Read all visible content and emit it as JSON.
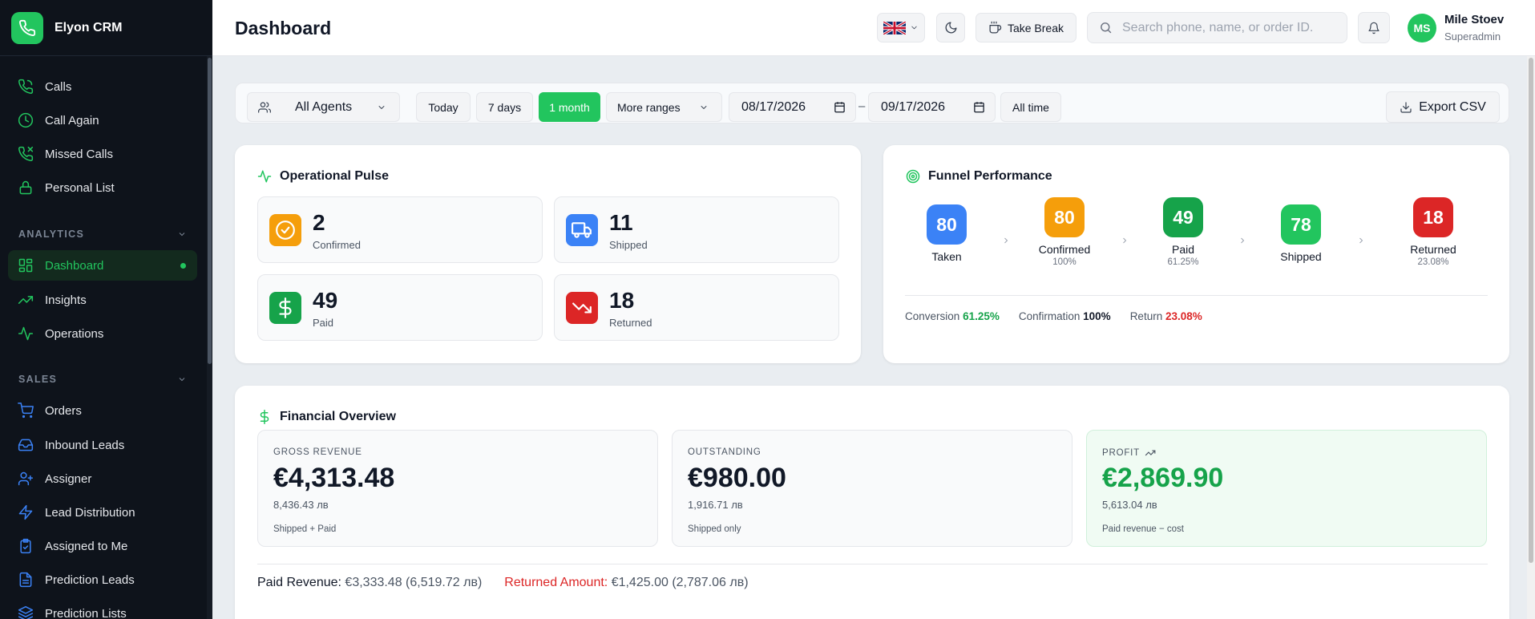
{
  "app": {
    "name": "Elyon CRM"
  },
  "sidebar": {
    "top_items": [
      {
        "label": "Calls",
        "icon": "phone-icon"
      },
      {
        "label": "Call Again",
        "icon": "clock-icon"
      },
      {
        "label": "Missed Calls",
        "icon": "phone-missed-icon"
      },
      {
        "label": "Personal List",
        "icon": "lock-icon"
      }
    ],
    "analytics": {
      "title": "ANALYTICS",
      "items": [
        {
          "label": "Dashboard",
          "icon": "grid-icon",
          "active": true
        },
        {
          "label": "Insights",
          "icon": "trending-up-icon"
        },
        {
          "label": "Operations",
          "icon": "activity-icon"
        }
      ]
    },
    "sales": {
      "title": "SALES",
      "items": [
        {
          "label": "Orders",
          "icon": "cart-icon"
        },
        {
          "label": "Inbound Leads",
          "icon": "inbox-icon"
        },
        {
          "label": "Assigner",
          "icon": "user-plus-icon"
        },
        {
          "label": "Lead Distribution",
          "icon": "zap-icon"
        },
        {
          "label": "Assigned to Me",
          "icon": "clipboard-icon"
        },
        {
          "label": "Prediction Leads",
          "icon": "file-icon"
        },
        {
          "label": "Prediction Lists",
          "icon": "layers-icon"
        }
      ]
    }
  },
  "header": {
    "title": "Dashboard",
    "take_break": "Take Break",
    "search_placeholder": "Search phone, name, or order ID.",
    "user": {
      "initials": "MS",
      "name": "Mile Stoev",
      "role": "Superadmin"
    }
  },
  "filters": {
    "agents": "All Agents",
    "today": "Today",
    "seven_days": "7 days",
    "one_month": "1 month",
    "more_ranges": "More ranges",
    "date_from": "08/17/2026",
    "date_sep": "–",
    "date_to": "09/17/2026",
    "all_time": "All time",
    "export": "Export CSV"
  },
  "pulse": {
    "title": "Operational Pulse",
    "stats": [
      {
        "value": "2",
        "label": "Confirmed",
        "color": "#f59e0b"
      },
      {
        "value": "11",
        "label": "Shipped",
        "color": "#3b82f6"
      },
      {
        "value": "49",
        "label": "Paid",
        "color": "#16a34a"
      },
      {
        "value": "18",
        "label": "Returned",
        "color": "#dc2626"
      }
    ]
  },
  "funnel": {
    "title": "Funnel Performance",
    "steps": [
      {
        "value": "80",
        "label": "Taken",
        "pct": "",
        "color": "#3b82f6"
      },
      {
        "value": "80",
        "label": "Confirmed",
        "pct": "100%",
        "color": "#f59e0b"
      },
      {
        "value": "49",
        "label": "Paid",
        "pct": "61.25%",
        "color": "#16a34a"
      },
      {
        "value": "78",
        "label": "Shipped",
        "pct": "",
        "color": "#22c55e"
      },
      {
        "value": "18",
        "label": "Returned",
        "pct": "23.08%",
        "color": "#dc2626"
      }
    ],
    "metrics": {
      "conversion_label": "Conversion",
      "conversion": "61.25%",
      "confirmation_label": "Confirmation",
      "confirmation": "100%",
      "return_label": "Return",
      "return": "23.08%"
    }
  },
  "financial": {
    "title": "Financial Overview",
    "cards": [
      {
        "label": "GROSS REVENUE",
        "value": "€4,313.48",
        "sub": "8,436.43 лв",
        "note": "Shipped + Paid"
      },
      {
        "label": "OUTSTANDING",
        "value": "€980.00",
        "sub": "1,916.71 лв",
        "note": "Shipped only"
      },
      {
        "label": "PROFIT",
        "value": "€2,869.90",
        "sub": "5,613.04 лв",
        "note": "Paid revenue − cost"
      }
    ],
    "paid_label": "Paid Revenue:",
    "paid_value": "€3,333.48 (6,519.72 лв)",
    "returned_label": "Returned Amount:",
    "returned_value": "€1,425.00 (2,787.06 лв)"
  }
}
